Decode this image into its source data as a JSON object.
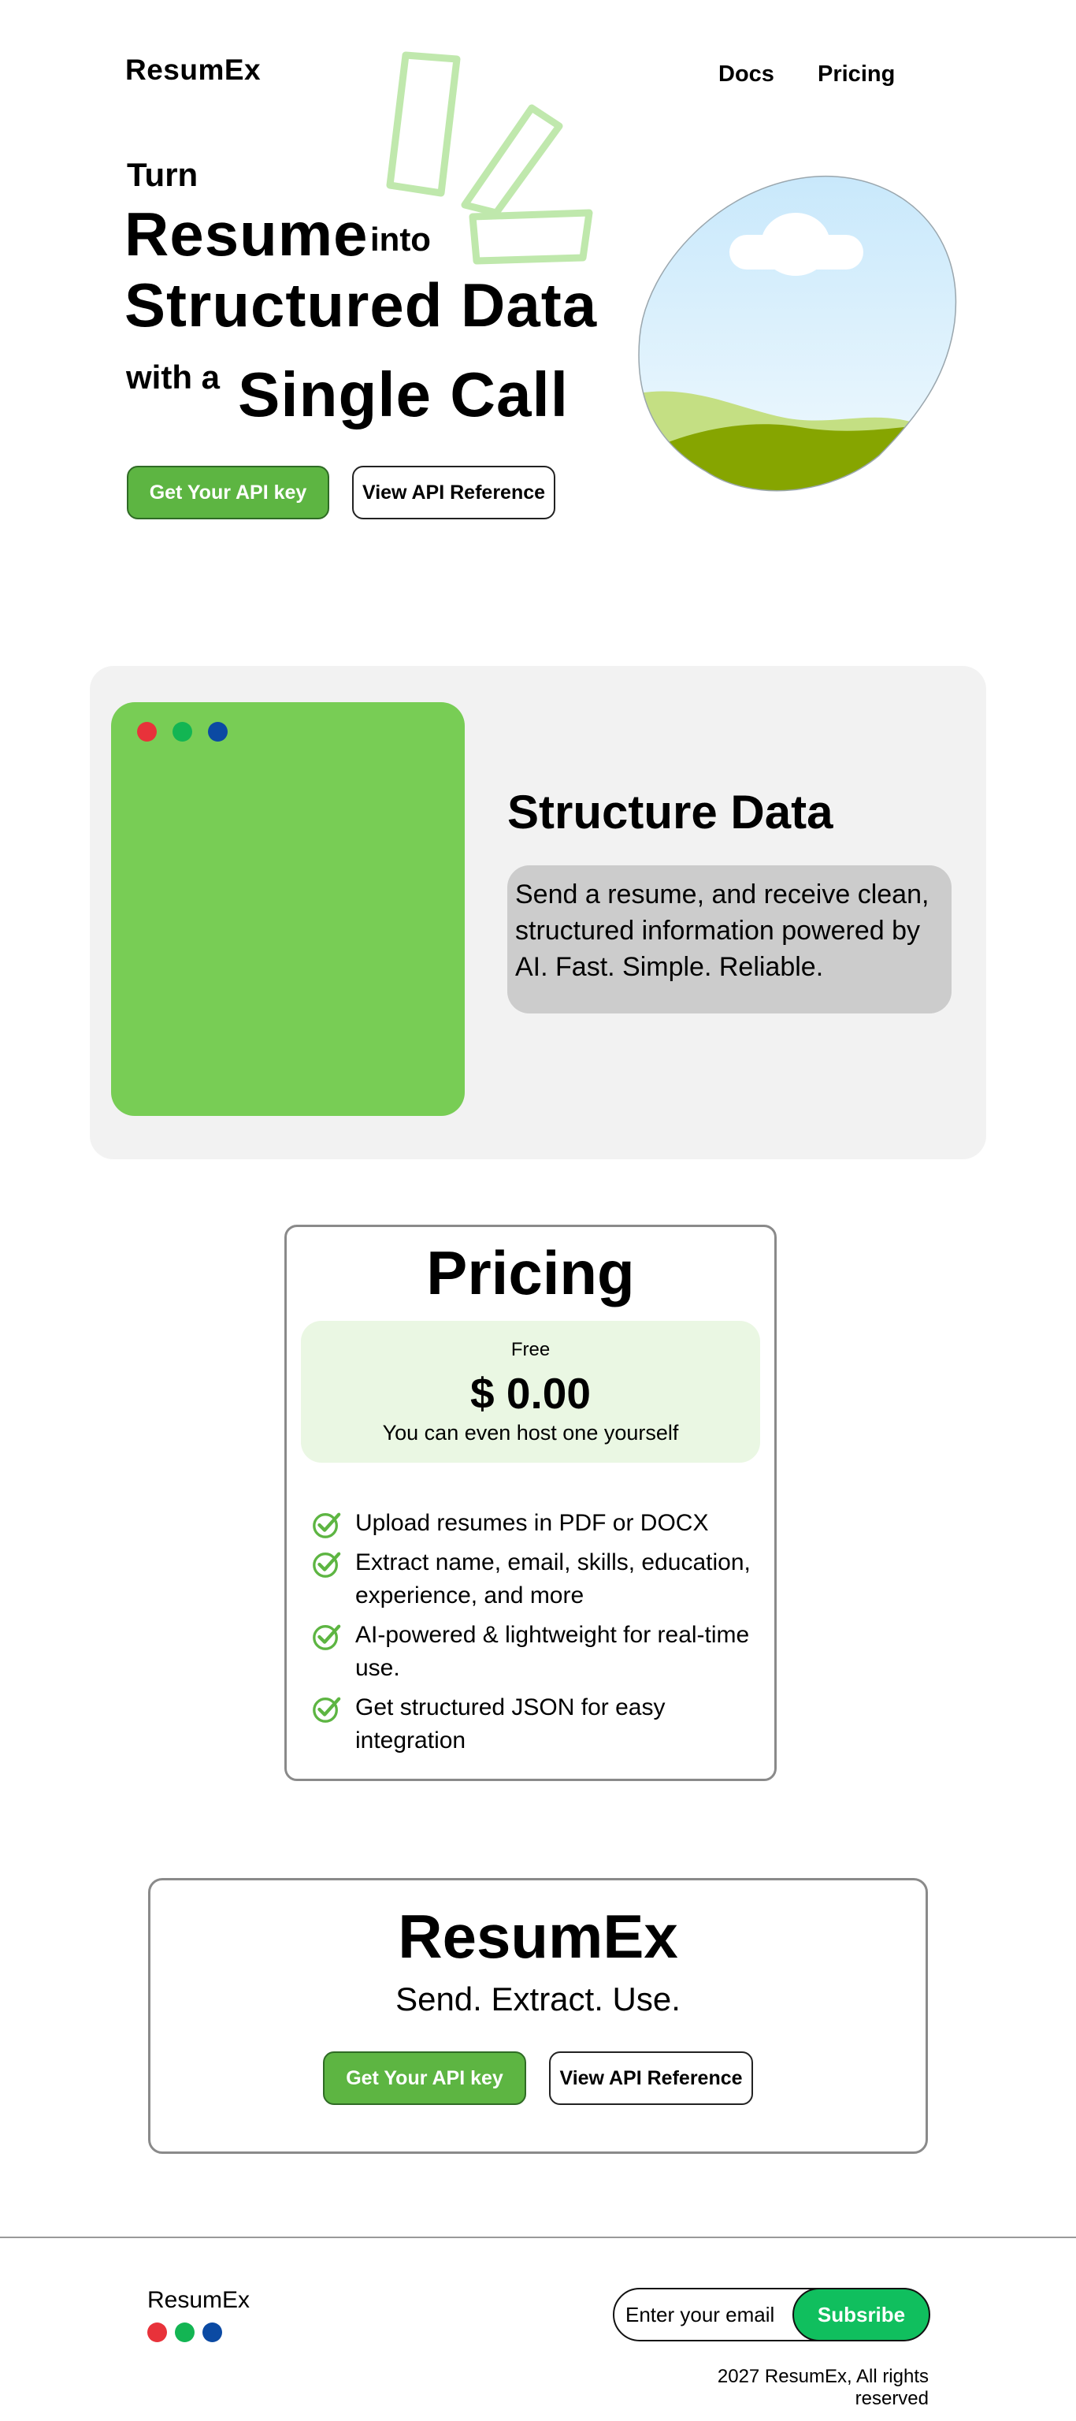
{
  "header": {
    "logo": "ResumEx",
    "nav": [
      {
        "label": "Docs"
      },
      {
        "label": "Pricing"
      }
    ]
  },
  "hero": {
    "line1": "Turn",
    "line2a": "Resume",
    "line2b": "into",
    "line3": "Structured Data",
    "line4a": "with a",
    "line4b": "Single Call",
    "primary_button": "Get Your API key",
    "secondary_button": "View API Reference"
  },
  "feature": {
    "title": "Structure Data",
    "description": "Send a resume, and receive clean, structured information powered by AI. Fast. Simple. Reliable."
  },
  "pricing": {
    "title": "Pricing",
    "plan_name": "Free",
    "price": "$ 0.00",
    "note": "You can even host one yourself",
    "features": [
      "Upload resumes in PDF or DOCX",
      "Extract name, email, skills, education, experience, and more",
      "AI-powered & lightweight for real-time use.",
      "Get structured JSON for easy integration"
    ]
  },
  "cta": {
    "title": "ResumEx",
    "tagline": "Send. Extract. Use.",
    "primary_button": "Get Your API key",
    "secondary_button": "View API Reference"
  },
  "footer": {
    "logo": "ResumEx",
    "email_placeholder": "Enter your email",
    "subscribe_button": "Subsribe",
    "copyright": "2027 ResumEx, All rights reserved"
  },
  "colors": {
    "accent_green": "#5db542",
    "window_green": "#78cd55",
    "subscribe_green": "#10bf5e",
    "dot_red": "#e8323a",
    "dot_green": "#13b553",
    "dot_blue": "#0b4aa3"
  },
  "icons": {
    "check": "check-circle-icon",
    "landscape": "landscape-illustration",
    "deco": "highlight-strokes"
  }
}
